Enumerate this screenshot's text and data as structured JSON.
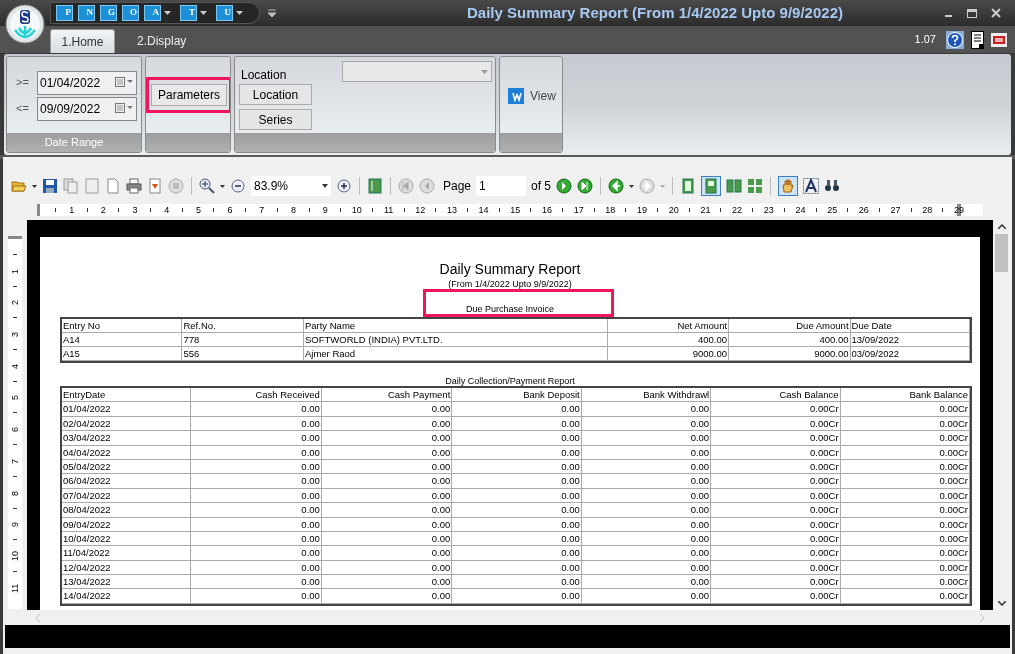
{
  "window": {
    "title": "Daily Summary Report (From 1/4/2022 Upto 9/9/2022)"
  },
  "quick_access": [
    {
      "label": "P",
      "dropdown": false
    },
    {
      "label": "N",
      "dropdown": false
    },
    {
      "label": "G",
      "dropdown": false
    },
    {
      "label": "O",
      "dropdown": false
    },
    {
      "label": "A",
      "dropdown": true
    },
    {
      "label": "T",
      "dropdown": true
    },
    {
      "label": "U",
      "dropdown": true
    }
  ],
  "tabs": [
    {
      "label": "1.Home",
      "selected": true
    },
    {
      "label": "2.Display",
      "selected": false
    }
  ],
  "version": "1.07",
  "ribbon": {
    "date_range": {
      "from_op": ">=",
      "from": "01/04/2022",
      "to_op": "<=",
      "to": "09/09/2022",
      "caption": "Date Range"
    },
    "parameters_button": "Parameters",
    "location_label": "Location",
    "location_button": "Location",
    "series_button": "Series",
    "view_button": "View"
  },
  "toolbar": {
    "zoom": "83.9%",
    "page_label": "Page",
    "page": "1",
    "page_of": "of 5"
  },
  "ruler_h": [
    "1",
    "2",
    "3",
    "4",
    "5",
    "6",
    "7",
    "8",
    "9",
    "10",
    "11",
    "12",
    "13",
    "14",
    "15",
    "16",
    "17",
    "18",
    "19",
    "20",
    "21",
    "22",
    "23",
    "24",
    "25",
    "26",
    "27",
    "28",
    "29"
  ],
  "ruler_v": [
    "1",
    "2",
    "3",
    "4",
    "5",
    "6",
    "7",
    "8",
    "9",
    "10",
    "11"
  ],
  "report": {
    "title": "Daily Summary Report",
    "subtitle": "(From 1/4/2022 Upto 9/9/2022)",
    "due_section": "Due Purchase Invoice",
    "due_columns": [
      "Entry No",
      "Ref.No.",
      "Party Name",
      "Net Amount",
      "Due Amount",
      "Due Date"
    ],
    "due_rows": [
      [
        "A14",
        "778",
        "SOFTWORLD (INDIA) PVT.LTD.",
        "400.00",
        "400.00",
        "13/09/2022"
      ],
      [
        "A15",
        "556",
        "Ajmer Raod",
        "9000.00",
        "9000.00",
        "03/09/2022"
      ]
    ],
    "daily_section": "Daily Collection/Payment Report",
    "daily_columns": [
      "EntryDate",
      "Cash Received",
      "Cash Payment",
      "Bank Deposit",
      "Bank Withdrawl",
      "Cash Balance",
      "Bank Balance"
    ],
    "daily_rows": [
      [
        "01/04/2022",
        "0.00",
        "0.00",
        "0.00",
        "0.00",
        "0.00Cr",
        "0.00Cr"
      ],
      [
        "02/04/2022",
        "0.00",
        "0.00",
        "0.00",
        "0.00",
        "0.00Cr",
        "0.00Cr"
      ],
      [
        "03/04/2022",
        "0.00",
        "0.00",
        "0.00",
        "0.00",
        "0.00Cr",
        "0.00Cr"
      ],
      [
        "04/04/2022",
        "0.00",
        "0.00",
        "0.00",
        "0.00",
        "0.00Cr",
        "0.00Cr"
      ],
      [
        "05/04/2022",
        "0.00",
        "0.00",
        "0.00",
        "0.00",
        "0.00Cr",
        "0.00Cr"
      ],
      [
        "06/04/2022",
        "0.00",
        "0.00",
        "0.00",
        "0.00",
        "0.00Cr",
        "0.00Cr"
      ],
      [
        "07/04/2022",
        "0.00",
        "0.00",
        "0.00",
        "0.00",
        "0.00Cr",
        "0.00Cr"
      ],
      [
        "08/04/2022",
        "0.00",
        "0.00",
        "0.00",
        "0.00",
        "0.00Cr",
        "0.00Cr"
      ],
      [
        "09/04/2022",
        "0.00",
        "0.00",
        "0.00",
        "0.00",
        "0.00Cr",
        "0.00Cr"
      ],
      [
        "10/04/2022",
        "0.00",
        "0.00",
        "0.00",
        "0.00",
        "0.00Cr",
        "0.00Cr"
      ],
      [
        "11/04/2022",
        "0.00",
        "0.00",
        "0.00",
        "0.00",
        "0.00Cr",
        "0.00Cr"
      ],
      [
        "12/04/2022",
        "0.00",
        "0.00",
        "0.00",
        "0.00",
        "0.00Cr",
        "0.00Cr"
      ],
      [
        "13/04/2022",
        "0.00",
        "0.00",
        "0.00",
        "0.00",
        "0.00Cr",
        "0.00Cr"
      ],
      [
        "14/04/2022",
        "0.00",
        "0.00",
        "0.00",
        "0.00",
        "0.00Cr",
        "0.00Cr"
      ]
    ]
  }
}
